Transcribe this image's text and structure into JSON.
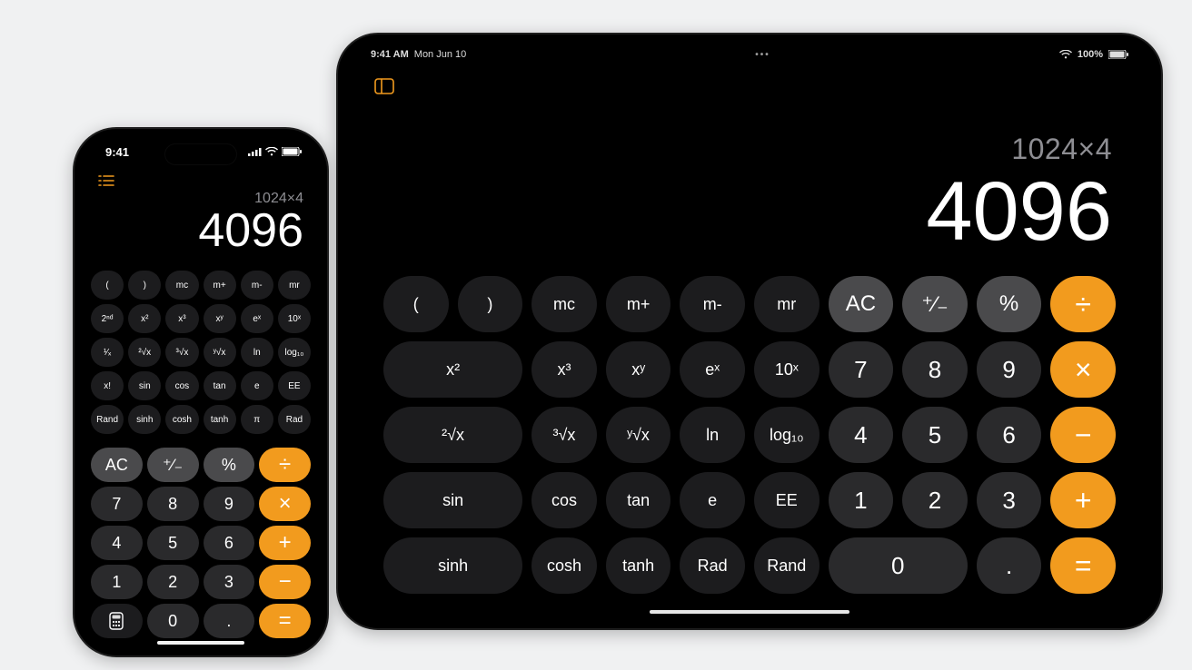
{
  "colors": {
    "accent": "#f29b1e",
    "bg": "#000000",
    "sci": "#1c1c1e",
    "num": "#2a2a2c",
    "util": "#4a4a4c"
  },
  "iphone": {
    "status": {
      "time": "9:41"
    },
    "display": {
      "expression": "1024×4",
      "result": "4096"
    },
    "sci_pad": [
      [
        "(",
        ")",
        "mc",
        "m+",
        "m-",
        "mr"
      ],
      [
        "2ⁿᵈ",
        "x²",
        "x³",
        "xʸ",
        "eˣ",
        "10ˣ"
      ],
      [
        "¹⁄ₓ",
        "²√x",
        "³√x",
        "ʸ√x",
        "ln",
        "log₁₀"
      ],
      [
        "x!",
        "sin",
        "cos",
        "tan",
        "e",
        "EE"
      ],
      [
        "Rand",
        "sinh",
        "cosh",
        "tanh",
        "π",
        "Rad"
      ]
    ],
    "basic_pad": [
      {
        "label": "AC",
        "kind": "util",
        "name": "ac-button"
      },
      {
        "label": "⁺∕₋",
        "kind": "util",
        "name": "sign-button"
      },
      {
        "label": "%",
        "kind": "util",
        "name": "percent-button"
      },
      {
        "label": "÷",
        "kind": "op",
        "name": "divide-button"
      },
      {
        "label": "7",
        "kind": "num",
        "name": "digit-7"
      },
      {
        "label": "8",
        "kind": "num",
        "name": "digit-8"
      },
      {
        "label": "9",
        "kind": "num",
        "name": "digit-9"
      },
      {
        "label": "×",
        "kind": "op",
        "name": "multiply-button"
      },
      {
        "label": "4",
        "kind": "num",
        "name": "digit-4"
      },
      {
        "label": "5",
        "kind": "num",
        "name": "digit-5"
      },
      {
        "label": "6",
        "kind": "num",
        "name": "digit-6"
      },
      {
        "label": "+",
        "kind": "op",
        "name": "plus-button"
      },
      {
        "label": "1",
        "kind": "num",
        "name": "digit-1"
      },
      {
        "label": "2",
        "kind": "num",
        "name": "digit-2"
      },
      {
        "label": "3",
        "kind": "num",
        "name": "digit-3"
      },
      {
        "label": "−",
        "kind": "op",
        "name": "minus-button"
      },
      {
        "label": "calc-icon",
        "kind": "numsci",
        "name": "calculator-mode-button",
        "icon": true
      },
      {
        "label": "0",
        "kind": "num",
        "name": "digit-0"
      },
      {
        "label": ".",
        "kind": "num",
        "name": "decimal-button"
      },
      {
        "label": "=",
        "kind": "op",
        "name": "equals-button"
      }
    ]
  },
  "ipad": {
    "status": {
      "time": "9:41 AM",
      "date": "Mon Jun 10",
      "battery": "100%"
    },
    "display": {
      "expression": "1024×4",
      "result": "4096"
    },
    "keypad": [
      {
        "label": "(",
        "kind": "sci",
        "name": "lparen-button"
      },
      {
        "label": ")",
        "kind": "sci",
        "name": "rparen-button"
      },
      {
        "label": "mc",
        "kind": "sci",
        "name": "mc-button"
      },
      {
        "label": "m+",
        "kind": "sci",
        "name": "mplus-button"
      },
      {
        "label": "m-",
        "kind": "sci",
        "name": "mminus-button"
      },
      {
        "label": "mr",
        "kind": "sci",
        "name": "mr-button"
      },
      {
        "label": "AC",
        "kind": "util",
        "name": "ac-button"
      },
      {
        "label": "⁺∕₋",
        "kind": "util",
        "name": "sign-button"
      },
      {
        "label": "%",
        "kind": "util",
        "name": "percent-button"
      },
      {
        "label": "÷",
        "kind": "op",
        "name": "divide-button"
      },
      {
        "label": "x²",
        "kind": "sci",
        "name": "x-squared-button"
      },
      {
        "label": "x³",
        "kind": "sci",
        "name": "x-cubed-button"
      },
      {
        "label": "xʸ",
        "kind": "sci",
        "name": "x-pow-y-button"
      },
      {
        "label": "eˣ",
        "kind": "sci",
        "name": "e-pow-x-button"
      },
      {
        "label": "10ˣ",
        "kind": "sci",
        "name": "ten-pow-x-button"
      },
      {
        "label": "7",
        "kind": "num",
        "name": "digit-7"
      },
      {
        "label": "8",
        "kind": "num",
        "name": "digit-8"
      },
      {
        "label": "9",
        "kind": "num",
        "name": "digit-9"
      },
      {
        "label": "×",
        "kind": "op",
        "name": "multiply-button"
      },
      {
        "label": "²√x",
        "kind": "sci",
        "name": "sqrt-button"
      },
      {
        "label": "³√x",
        "kind": "sci",
        "name": "cbrt-button"
      },
      {
        "label": "ʸ√x",
        "kind": "sci",
        "name": "yroot-button"
      },
      {
        "label": "ln",
        "kind": "sci",
        "name": "ln-button"
      },
      {
        "label": "log₁₀",
        "kind": "sci",
        "name": "log10-button"
      },
      {
        "label": "4",
        "kind": "num",
        "name": "digit-4"
      },
      {
        "label": "5",
        "kind": "num",
        "name": "digit-5"
      },
      {
        "label": "6",
        "kind": "num",
        "name": "digit-6"
      },
      {
        "label": "−",
        "kind": "op",
        "name": "minus-button"
      },
      {
        "label": "sin",
        "kind": "sci",
        "name": "sin-button"
      },
      {
        "label": "cos",
        "kind": "sci",
        "name": "cos-button"
      },
      {
        "label": "tan",
        "kind": "sci",
        "name": "tan-button"
      },
      {
        "label": "e",
        "kind": "sci",
        "name": "e-button"
      },
      {
        "label": "EE",
        "kind": "sci",
        "name": "ee-button"
      },
      {
        "label": "1",
        "kind": "num",
        "name": "digit-1"
      },
      {
        "label": "2",
        "kind": "num",
        "name": "digit-2"
      },
      {
        "label": "3",
        "kind": "num",
        "name": "digit-3"
      },
      {
        "label": "+",
        "kind": "op",
        "name": "plus-button"
      },
      {
        "label": "sinh",
        "kind": "sci",
        "name": "sinh-button"
      },
      {
        "label": "cosh",
        "kind": "sci",
        "name": "cosh-button"
      },
      {
        "label": "tanh",
        "kind": "sci",
        "name": "tanh-button"
      },
      {
        "label": "Rad",
        "kind": "sci",
        "name": "rad-button"
      },
      {
        "label": "Rand",
        "kind": "sci",
        "name": "rand-button"
      },
      {
        "label": "0",
        "kind": "num",
        "name": "digit-0",
        "wide": 2
      },
      {
        "label": ".",
        "kind": "num",
        "name": "decimal-button"
      },
      {
        "label": "=",
        "kind": "op",
        "name": "equals-button"
      }
    ]
  }
}
